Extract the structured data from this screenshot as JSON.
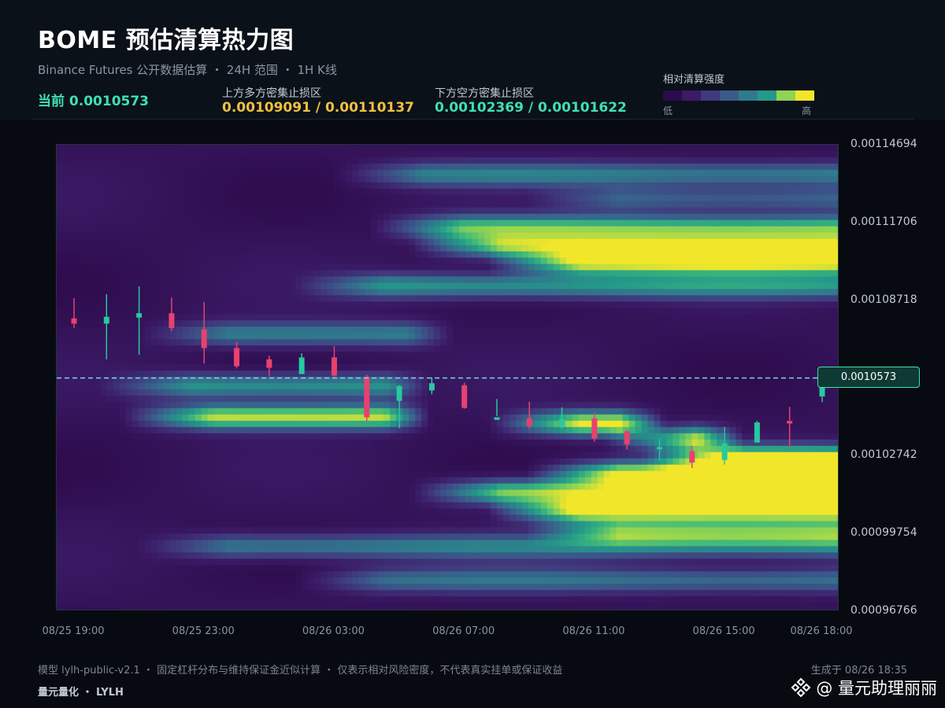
{
  "header": {
    "title": "BOME 预估清算热力图",
    "subtitle": "Binance Futures 公开数据估算 ・ 24H 范围 ・ 1H K线",
    "current_text": "当前 0.0010573",
    "upper_label": "上方多方密集止损区",
    "upper_value": "0.00109091 / 0.00110137",
    "lower_label": "下方空方密集止损区",
    "lower_value": "0.00102369 / 0.00101622",
    "legend_label": "相对清算强度",
    "legend_low": "低",
    "legend_high": "高"
  },
  "colors": {
    "background": "#070a10",
    "up_candle": "#26c9a0",
    "down_candle": "#e8416f",
    "current_line": "#7fd6e8",
    "accent": "#3fe0b0",
    "upper_accent": "#f0c040",
    "colormap": [
      "#2d0b4c",
      "#3b1b66",
      "#40397d",
      "#3a5a8a",
      "#2f7b8c",
      "#24998a",
      "#3fb97a",
      "#8fd453",
      "#f2e62a"
    ]
  },
  "chart_data": {
    "type": "heatmap",
    "title": "BOME 预估清算热力图",
    "x_ticks": [
      "08/25 19:00",
      "08/25 23:00",
      "08/26 03:00",
      "08/26 07:00",
      "08/26 11:00",
      "08/26 15:00",
      "08/26 18:00"
    ],
    "y_ticks": [
      "0.00114694",
      "0.00111706",
      "0.00108718",
      "0.00105730",
      "0.00102742",
      "0.00099754",
      "0.00096766"
    ],
    "y_tick_labels": [
      "0.00114694",
      "0.00111706",
      "0.00108718",
      "",
      "0.00102742",
      "0.00099754",
      "0.00096766"
    ],
    "ylim": [
      0.00096766,
      0.00114694
    ],
    "current_price": 0.0010573,
    "current_price_label": "0.0010573",
    "candles": [
      {
        "t": "08/25 19:00",
        "open": 0.0010802,
        "high": 0.001088,
        "low": 0.0010765,
        "close": 0.0010782
      },
      {
        "t": "08/25 20:00",
        "open": 0.0010782,
        "high": 0.0010895,
        "low": 0.0010645,
        "close": 0.0010808
      },
      {
        "t": "08/25 21:00",
        "open": 0.0010805,
        "high": 0.0010925,
        "low": 0.0010662,
        "close": 0.0010822
      },
      {
        "t": "08/25 22:00",
        "open": 0.0010822,
        "high": 0.0010882,
        "low": 0.0010753,
        "close": 0.0010765
      },
      {
        "t": "08/25 23:00",
        "open": 0.001076,
        "high": 0.0010865,
        "low": 0.0010628,
        "close": 0.0010688
      },
      {
        "t": "08/26 00:00",
        "open": 0.0010688,
        "high": 0.0010711,
        "low": 0.001061,
        "close": 0.0010618
      },
      {
        "t": "08/26 01:00",
        "open": 0.0010645,
        "high": 0.0010659,
        "low": 0.001058,
        "close": 0.0010612
      },
      {
        "t": "08/26 02:00",
        "open": 0.0010588,
        "high": 0.0010668,
        "low": 0.0010588,
        "close": 0.0010652
      },
      {
        "t": "08/26 03:00",
        "open": 0.0010652,
        "high": 0.0010695,
        "low": 0.0010575,
        "close": 0.0010582
      },
      {
        "t": "08/26 04:00",
        "open": 0.0010578,
        "high": 0.0010585,
        "low": 0.0010408,
        "close": 0.0010422
      },
      {
        "t": "08/26 05:00",
        "open": 0.0010485,
        "high": 0.0010545,
        "low": 0.001038,
        "close": 0.0010542
      },
      {
        "t": "08/26 06:00",
        "open": 0.0010525,
        "high": 0.0010575,
        "low": 0.001051,
        "close": 0.0010553
      },
      {
        "t": "08/26 07:00",
        "open": 0.0010545,
        "high": 0.0010555,
        "low": 0.0010455,
        "close": 0.0010458
      },
      {
        "t": "08/26 08:00",
        "open": 0.0010412,
        "high": 0.0010492,
        "low": 0.0010427,
        "close": 0.0010422
      },
      {
        "t": "08/26 09:00",
        "open": 0.0010418,
        "high": 0.0010482,
        "low": 0.0010378,
        "close": 0.0010388
      },
      {
        "t": "08/26 10:00",
        "open": 0.001039,
        "high": 0.001046,
        "low": 0.0010378,
        "close": 0.0010415
      },
      {
        "t": "08/26 11:00",
        "open": 0.0010418,
        "high": 0.001044,
        "low": 0.0010328,
        "close": 0.001034
      },
      {
        "t": "08/26 12:00",
        "open": 0.0010368,
        "high": 0.0010375,
        "low": 0.0010298,
        "close": 0.0010318
      },
      {
        "t": "08/26 13:00",
        "open": 0.0010306,
        "high": 0.0010341,
        "low": 0.0010256,
        "close": 0.0010308
      },
      {
        "t": "08/26 14:00",
        "open": 0.0010292,
        "high": 0.0010312,
        "low": 0.0010227,
        "close": 0.0010248
      },
      {
        "t": "08/26 15:00",
        "open": 0.0010258,
        "high": 0.0010385,
        "low": 0.001024,
        "close": 0.0010322
      },
      {
        "t": "08/26 16:00",
        "open": 0.0010325,
        "high": 0.0010408,
        "low": 0.0010328,
        "close": 0.0010402
      },
      {
        "t": "08/26 17:00",
        "open": 0.0010408,
        "high": 0.0010462,
        "low": 0.0010305,
        "close": 0.0010398
      },
      {
        "t": "08/26 18:00",
        "open": 0.0010502,
        "high": 0.001061,
        "low": 0.001048,
        "close": 0.0010555
      }
    ],
    "zones": [
      {
        "y": 0.0011355,
        "intensity": 0.45,
        "start": 0.35,
        "end": 1.0
      },
      {
        "y": 0.001126,
        "intensity": 0.35,
        "start": 0.6,
        "end": 1.0
      },
      {
        "y": 0.001115,
        "intensity": 0.7,
        "start": 0.4,
        "end": 1.0
      },
      {
        "y": 0.001108,
        "intensity": 0.8,
        "start": 0.45,
        "end": 1.0
      },
      {
        "y": 0.0011015,
        "intensity": 0.92,
        "start": 0.55,
        "end": 1.0
      },
      {
        "y": 0.0010925,
        "intensity": 0.55,
        "start": 0.3,
        "end": 1.0
      },
      {
        "y": 0.001074,
        "intensity": 0.45,
        "start": 0.1,
        "end": 0.45
      },
      {
        "y": 0.001054,
        "intensity": 0.55,
        "start": 0.05,
        "end": 0.42
      },
      {
        "y": 0.001042,
        "intensity": 0.88,
        "start": 0.08,
        "end": 0.42
      },
      {
        "y": 0.0010395,
        "intensity": 0.95,
        "start": 0.55,
        "end": 0.72
      },
      {
        "y": 0.0010335,
        "intensity": 0.85,
        "start": 0.7,
        "end": 0.82
      },
      {
        "y": 0.001026,
        "intensity": 1.0,
        "start": 0.75,
        "end": 1.0
      },
      {
        "y": 0.00102,
        "intensity": 0.95,
        "start": 0.6,
        "end": 1.0
      },
      {
        "y": 0.001013,
        "intensity": 0.8,
        "start": 0.45,
        "end": 1.0
      },
      {
        "y": 0.001006,
        "intensity": 0.98,
        "start": 0.55,
        "end": 1.0
      },
      {
        "y": 0.0009975,
        "intensity": 0.7,
        "start": 0.6,
        "end": 1.0
      },
      {
        "y": 0.000992,
        "intensity": 0.45,
        "start": 0.1,
        "end": 1.0
      },
      {
        "y": 0.000979,
        "intensity": 0.4,
        "start": 0.3,
        "end": 1.0
      }
    ]
  },
  "footer": {
    "note": "模型 lylh-public-v2.1 ・ 固定杠杆分布与维持保证金近似计算 ・ 仅表示相对风险密度，不代表真实挂单或保证收益",
    "generated": "生成于 08/26 18:35",
    "brand": "量元量化 ・ LYLH",
    "watermark": "@ 量元助理丽丽"
  }
}
